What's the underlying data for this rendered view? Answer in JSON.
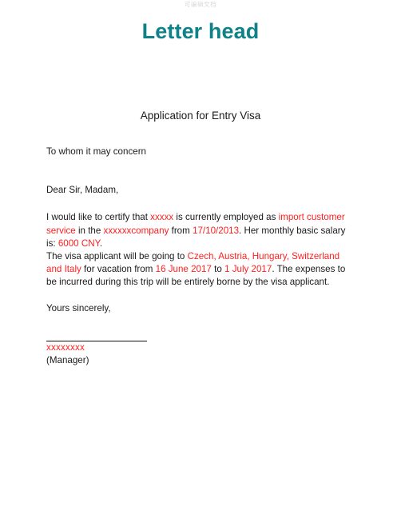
{
  "watermark": {
    "text": "可编辑文档"
  },
  "header": {
    "letterhead": "Letter head",
    "letterhead_color": "#0f8289"
  },
  "document": {
    "title": "Application for Entry Visa",
    "salutation_to": "To whom it may concern",
    "salutation_dear": "Dear Sir, Madam,",
    "closing": "Yours sincerely,"
  },
  "highlight_color": "#ff2020",
  "paragraph1": {
    "seg1": "I would like to certify that ",
    "employee_name": "xxxxx",
    "seg2": " is currently employed as ",
    "job_title": "import customer service",
    "seg3": " in the ",
    "company": "xxxxxxcompany",
    "seg4": " from ",
    "hire_date": "17/10/2013",
    "seg5": ". Her monthly basic salary is: ",
    "salary": "6000 CNY",
    "seg6": "."
  },
  "paragraph2": {
    "seg1": "The visa applicant will be going to ",
    "destinations": "Czech, Austria, Hungary, Switzerland and Italy",
    "seg2": " for vacation from ",
    "start_date": "16 June 2017",
    "seg3": " to ",
    "end_date": "1 July 2017",
    "seg4": ". The expenses to be incurred during this trip will be entirely borne by the visa applicant."
  },
  "signature": {
    "rule": "",
    "name": "xxxxxxxx",
    "role": "(Manager)"
  },
  "footer": {
    "mark": "."
  }
}
